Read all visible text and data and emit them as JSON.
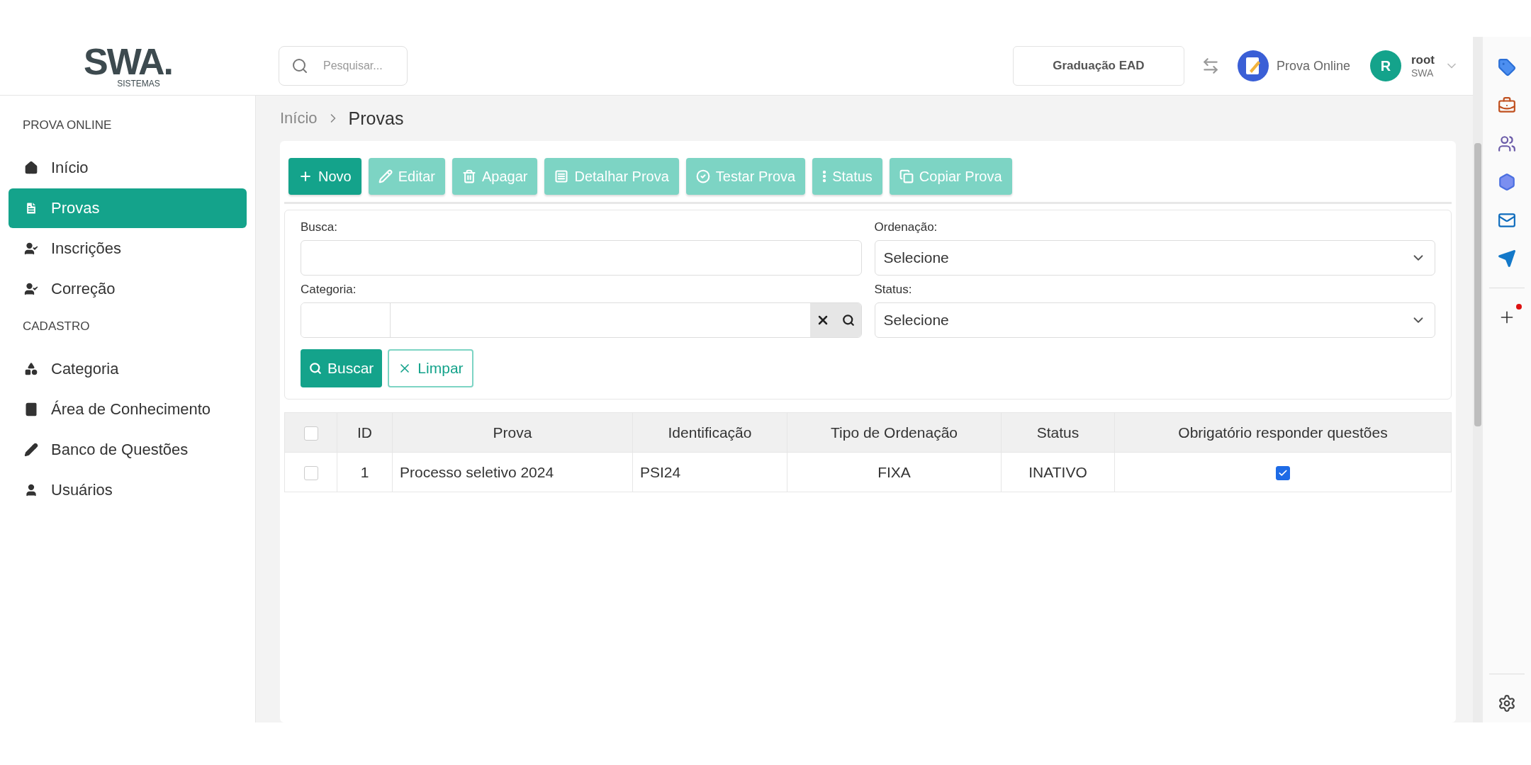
{
  "logo": {
    "mark": "SWA.",
    "sub": "SISTEMAS"
  },
  "header": {
    "search": {
      "placeholder": "Pesquisar..."
    },
    "unit": "Graduação EAD",
    "app": "Prova Online",
    "user": {
      "initial": "R",
      "name": "root",
      "org": "SWA"
    }
  },
  "sidebar": {
    "sections": [
      {
        "title": "PROVA ONLINE",
        "items": [
          {
            "label": "Início",
            "selected": false
          },
          {
            "label": "Provas",
            "selected": true
          },
          {
            "label": "Inscrições",
            "selected": false
          },
          {
            "label": "Correção",
            "selected": false
          }
        ]
      },
      {
        "title": "CADASTRO",
        "items": [
          {
            "label": "Categoria",
            "selected": false
          },
          {
            "label": "Área de Conhecimento",
            "selected": false
          },
          {
            "label": "Banco de Questões",
            "selected": false
          },
          {
            "label": "Usuários",
            "selected": false
          }
        ]
      }
    ]
  },
  "breadcrumb": [
    "Início",
    "Provas"
  ],
  "toolbar": [
    {
      "label": "Novo",
      "disabled": false
    },
    {
      "label": "Editar",
      "disabled": true
    },
    {
      "label": "Apagar",
      "disabled": true
    },
    {
      "label": "Detalhar Prova",
      "disabled": true
    },
    {
      "label": "Testar Prova",
      "disabled": true
    },
    {
      "label": "Status",
      "disabled": true
    },
    {
      "label": "Copiar Prova",
      "disabled": true
    }
  ],
  "filters": {
    "busca": {
      "label": "Busca:"
    },
    "ordenacao": {
      "label": "Ordenação:",
      "value": "Selecione"
    },
    "categoria": {
      "label": "Categoria:"
    },
    "status": {
      "label": "Status:",
      "value": "Selecione"
    },
    "search_button": "Buscar",
    "clear_button": "Limpar"
  },
  "table": {
    "select_all": false,
    "columns": [
      "ID",
      "Prova",
      "Identificação",
      "Tipo de Ordenação",
      "Status",
      "Obrigatório responder questões"
    ],
    "rows": [
      {
        "selected": false,
        "id": "1",
        "prova": "Processo seletivo 2024",
        "identificacao": "PSI24",
        "tipo": "FIXA",
        "status": "INATIVO",
        "obrigatorio": true
      }
    ]
  }
}
